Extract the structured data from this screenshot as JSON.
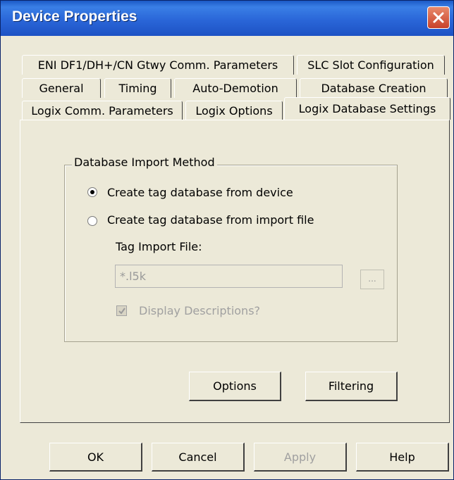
{
  "window": {
    "title": "Device Properties"
  },
  "tabs": {
    "row1": [
      "ENI DF1/DH+/CN Gtwy Comm. Parameters",
      "SLC Slot Configuration"
    ],
    "row2": [
      "General",
      "Timing",
      "Auto-Demotion",
      "Database Creation"
    ],
    "row3": [
      "Logix Comm. Parameters",
      "Logix Options",
      "Logix Database Settings"
    ],
    "active": "Logix Database Settings"
  },
  "group": {
    "label": "Database Import Method",
    "options": [
      {
        "label": "Create tag database from device",
        "selected": true
      },
      {
        "label": "Create tag database from import file",
        "selected": false
      }
    ],
    "import_file_label": "Tag Import File:",
    "import_file_value": "*.l5k",
    "browse_label": "...",
    "display_descriptions_label": "Display Descriptions?",
    "display_descriptions_checked": true
  },
  "buttons": {
    "options": "Options",
    "filtering": "Filtering"
  },
  "footer": {
    "ok": "OK",
    "cancel": "Cancel",
    "apply": "Apply",
    "help": "Help"
  }
}
